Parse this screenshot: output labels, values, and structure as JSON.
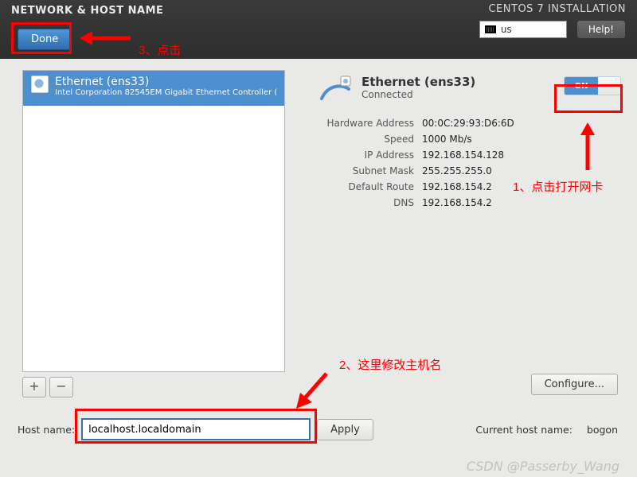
{
  "header": {
    "title": "NETWORK & HOST NAME",
    "install_title": "CENTOS 7 INSTALLATION",
    "keyboard_layout": "us",
    "help_label": "Help!",
    "done_label": "Done"
  },
  "annotations": {
    "a1": "1、点击打开网卡",
    "a2": "2、这里修改主机名",
    "a3": "3、点击"
  },
  "nic_list": {
    "items": [
      {
        "title": "Ethernet (ens33)",
        "subtitle": "Intel Corporation 82545EM Gigabit Ethernet Controller ("
      }
    ]
  },
  "list_buttons": {
    "add": "+",
    "remove": "−"
  },
  "detail": {
    "title": "Ethernet (ens33)",
    "status": "Connected",
    "toggle_on": "ON",
    "props": [
      {
        "label": "Hardware Address",
        "value": "00:0C:29:93:D6:6D"
      },
      {
        "label": "Speed",
        "value": "1000 Mb/s"
      },
      {
        "label": "IP Address",
        "value": "192.168.154.128"
      },
      {
        "label": "Subnet Mask",
        "value": "255.255.255.0"
      },
      {
        "label": "Default Route",
        "value": "192.168.154.2"
      },
      {
        "label": "DNS",
        "value": "192.168.154.2"
      }
    ]
  },
  "buttons": {
    "configure": "Configure...",
    "apply": "Apply"
  },
  "hostname": {
    "label": "Host name:",
    "value": "localhost.localdomain",
    "current_label": "Current host name:",
    "current_value": "bogon"
  },
  "watermark": "CSDN @Passerby_Wang"
}
